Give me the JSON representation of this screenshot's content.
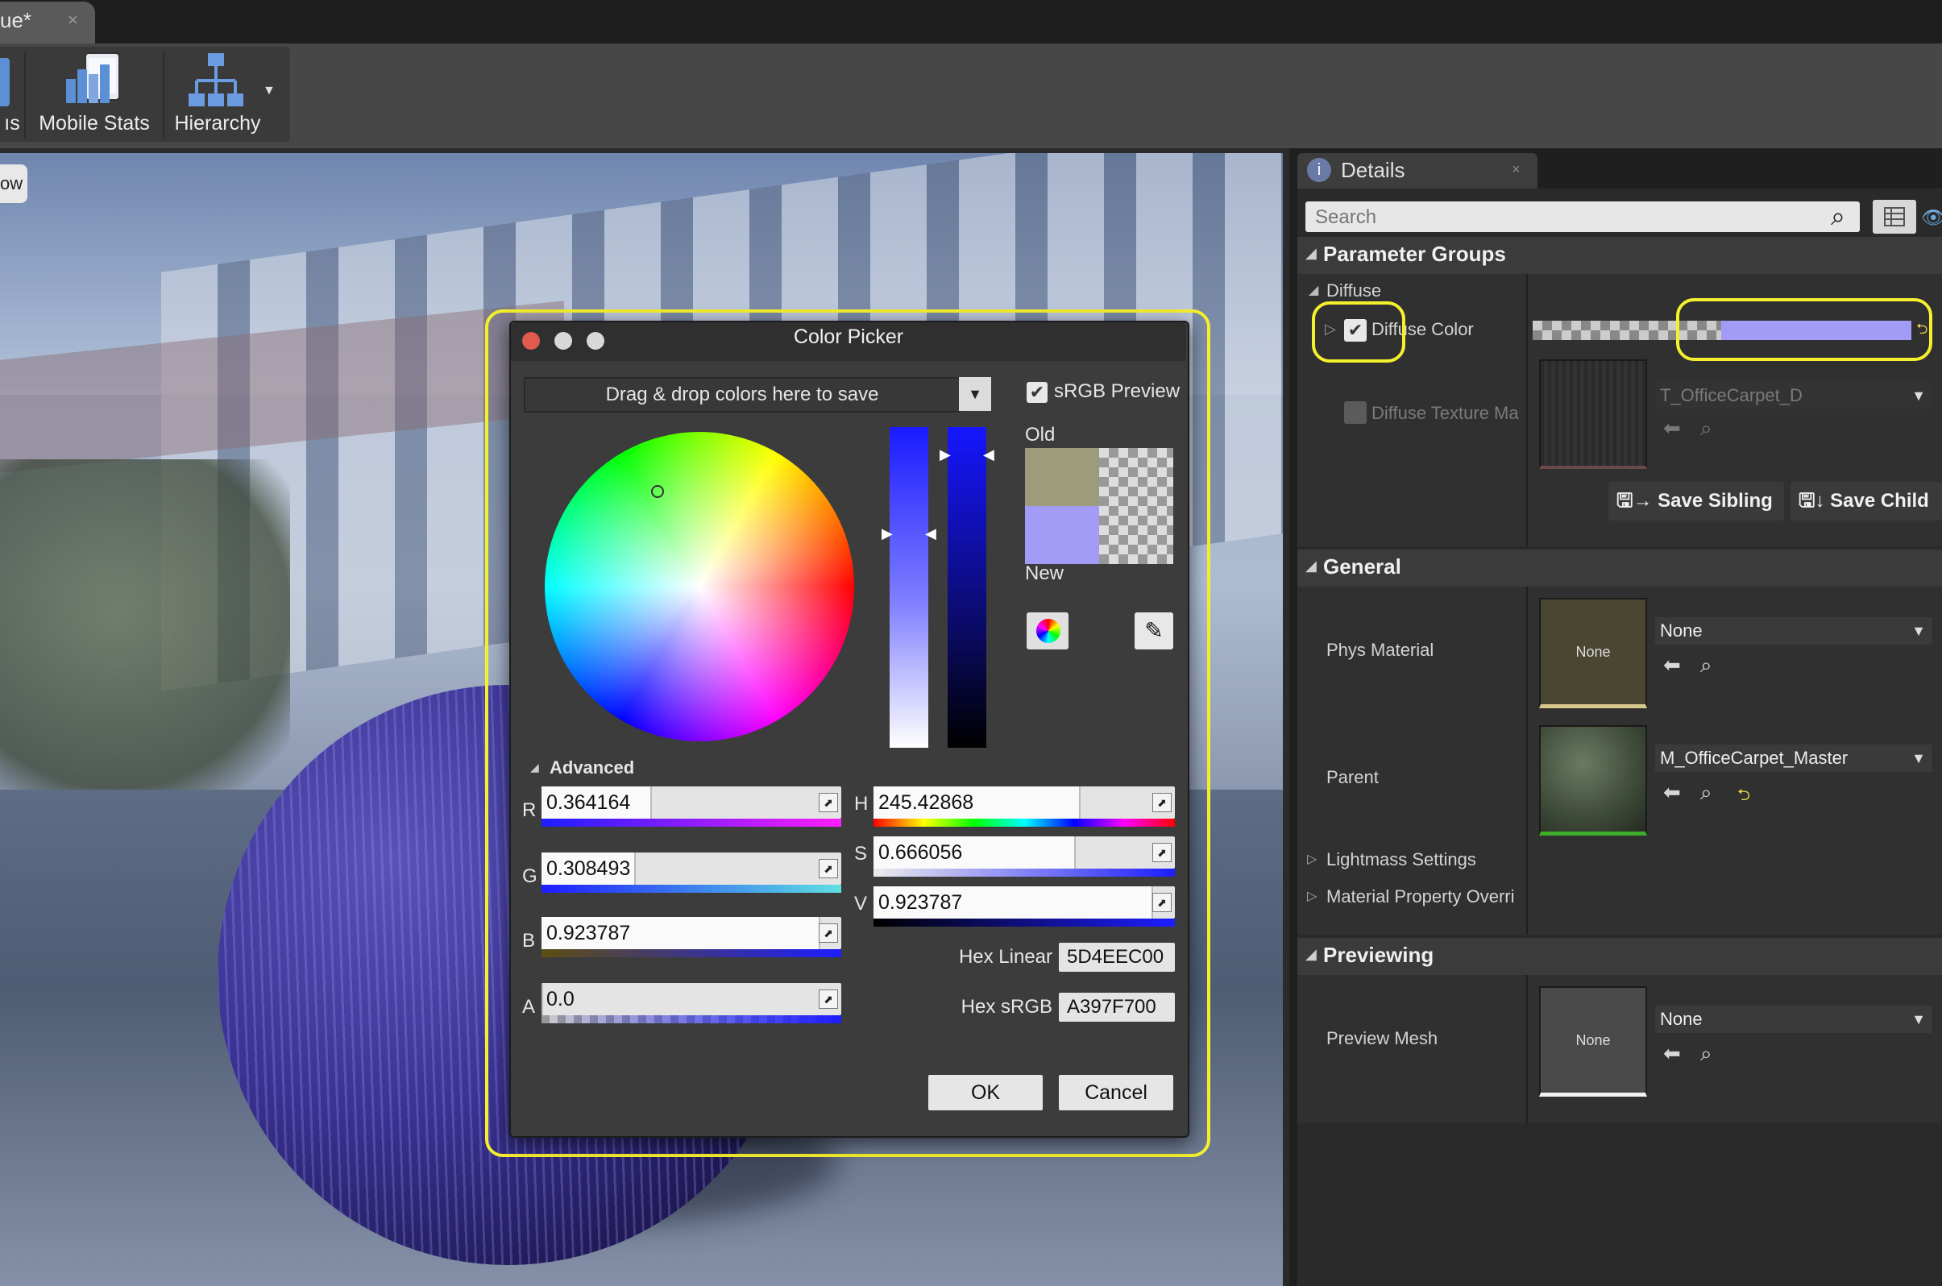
{
  "doc_tab": {
    "label": "ue*",
    "close": "×"
  },
  "toolbar": {
    "partial_label": "ıs",
    "mobile_stats_label": "Mobile Stats",
    "hierarchy_label": "Hierarchy"
  },
  "viewport": {
    "partial_button_label": "ow"
  },
  "details": {
    "tab_label": "Details",
    "tab_close": "×",
    "search_placeholder": "Search",
    "sections": {
      "parameter_groups": "Parameter Groups",
      "general": "General",
      "previewing": "Previewing"
    },
    "diffuse_group_label": "Diffuse",
    "diffuse_color_label": "Diffuse Color",
    "diffuse_color_value": "#a39cf7",
    "diffuse_texture_label": "Diffuse Texture Ma",
    "diffuse_texture_asset": "T_OfficeCarpet_D",
    "save_sibling_label": "Save Sibling",
    "save_child_label": "Save Child",
    "phys_material_label": "Phys Material",
    "phys_material_thumb_text": "None",
    "phys_material_value": "None",
    "parent_label": "Parent",
    "parent_value": "M_OfficeCarpet_Master",
    "lightmass_label": "Lightmass Settings",
    "material_property_label": "Material Property Overri",
    "preview_mesh_label": "Preview Mesh",
    "preview_mesh_thumb_text": "None",
    "preview_mesh_value": "None"
  },
  "color_picker": {
    "title": "Color Picker",
    "drag_drop_label": "Drag & drop colors here to save",
    "srgb_label": "sRGB Preview",
    "srgb_checked": true,
    "old_label": "Old",
    "new_label": "New",
    "old_color": "#9e9a7c",
    "new_color": "#a39cf7",
    "advanced_label": "Advanced",
    "channels": {
      "r": {
        "letter": "R",
        "value": "0.364164",
        "fill": 0.364164
      },
      "g": {
        "letter": "G",
        "value": "0.308493",
        "fill": 0.308493
      },
      "b": {
        "letter": "B",
        "value": "0.923787",
        "fill": 0.923787
      },
      "a": {
        "letter": "A",
        "value": "0.0",
        "fill": 0.0
      },
      "h": {
        "letter": "H",
        "value": "245.42868",
        "fill": 0.6817
      },
      "s": {
        "letter": "S",
        "value": "0.666056",
        "fill": 0.666056
      },
      "v": {
        "letter": "V",
        "value": "0.923787",
        "fill": 0.923787
      }
    },
    "hex_linear_label": "Hex Linear",
    "hex_linear_value": "5D4EEC00",
    "hex_srgb_label": "Hex sRGB",
    "hex_srgb_value": "A397F700",
    "ok_label": "OK",
    "cancel_label": "Cancel"
  },
  "colors": {
    "highlight": "#f5f02e",
    "panel_bg": "#2a2a2a",
    "dialog_bg": "#3c3c3c"
  }
}
